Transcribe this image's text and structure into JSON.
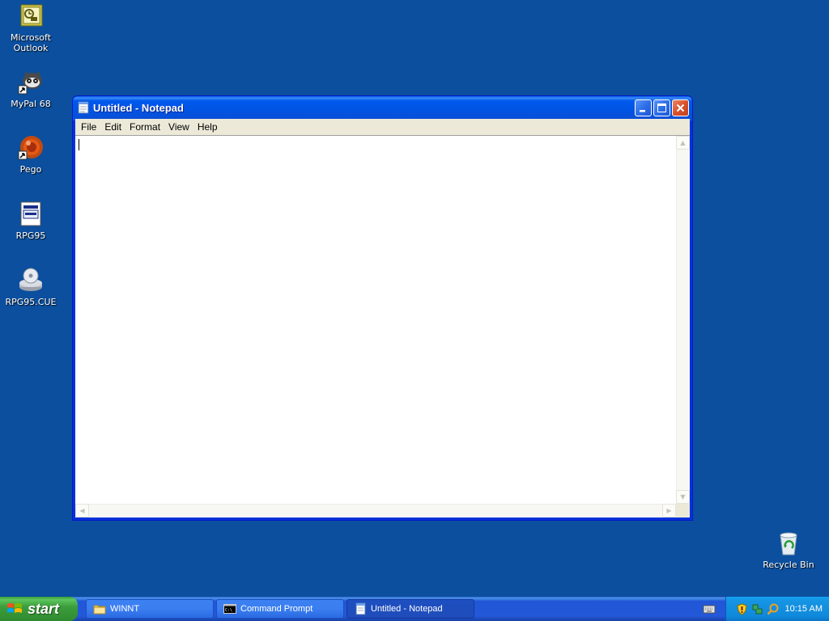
{
  "desktop": {
    "icons": [
      {
        "label": "Microsoft Outlook"
      },
      {
        "label": "MyPal 68"
      },
      {
        "label": "Pego"
      },
      {
        "label": "RPG95"
      },
      {
        "label": "RPG95.CUE"
      },
      {
        "label": "Recycle Bin"
      }
    ]
  },
  "window": {
    "title": "Untitled - Notepad",
    "menu": [
      "File",
      "Edit",
      "Format",
      "View",
      "Help"
    ],
    "content": ""
  },
  "taskbar": {
    "start_label": "start",
    "tasks": [
      {
        "label": "WINNT",
        "icon": "folder-icon"
      },
      {
        "label": "Command Prompt",
        "icon": "cmd-icon"
      },
      {
        "label": "Untitled - Notepad",
        "icon": "notepad-icon"
      }
    ],
    "clock": "10:15 AM"
  }
}
